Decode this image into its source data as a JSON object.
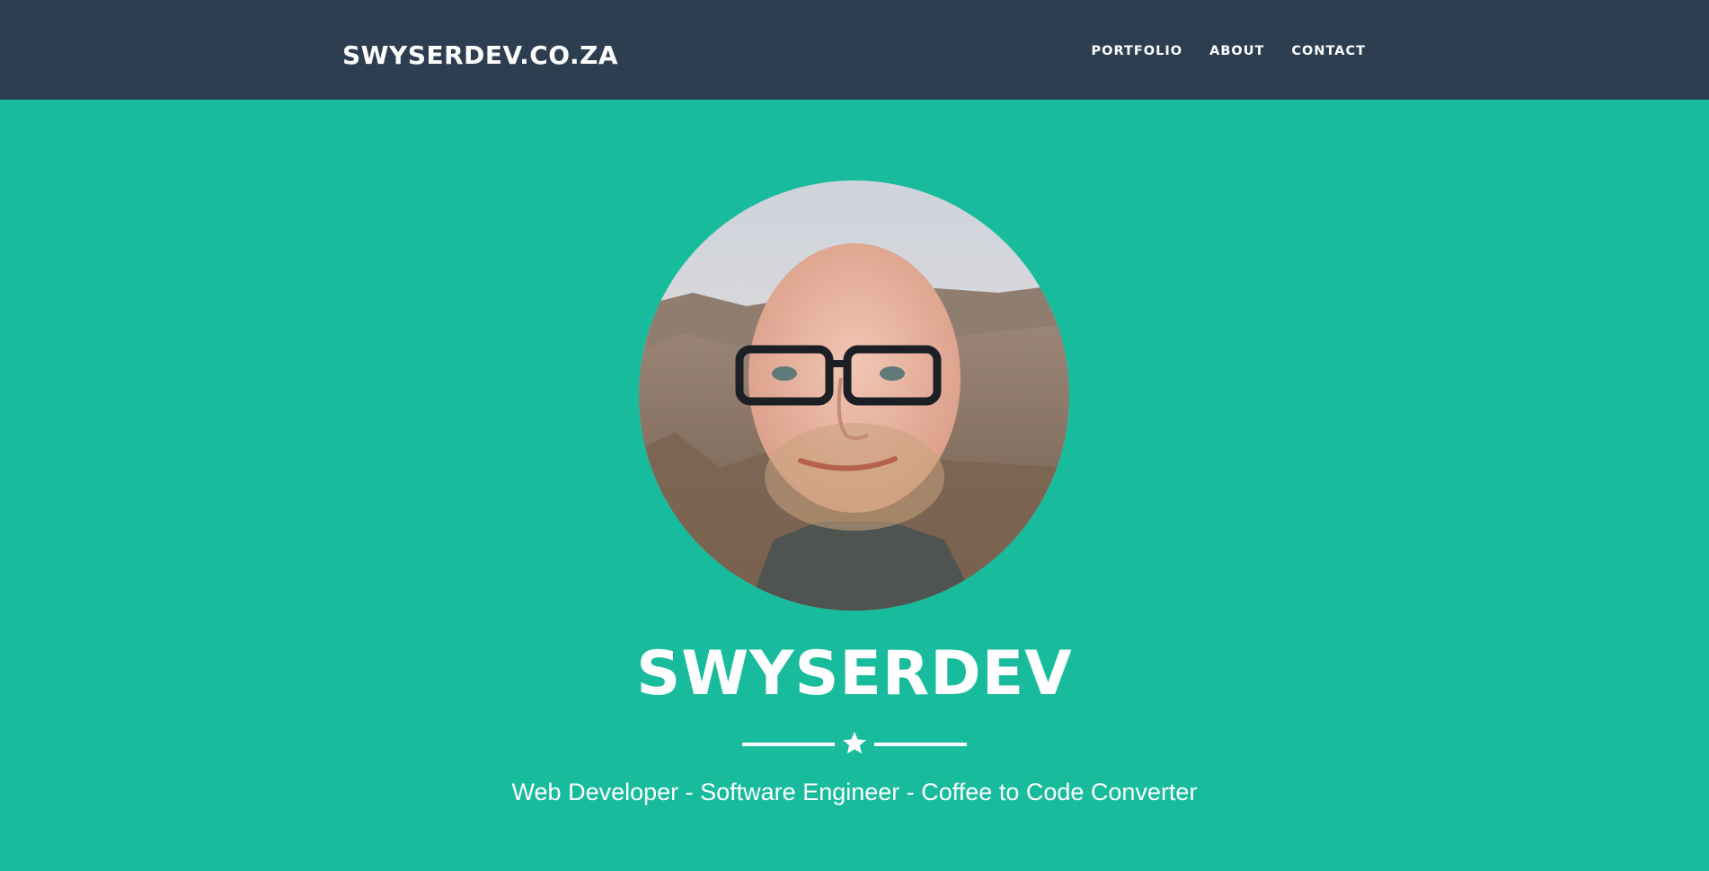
{
  "navbar": {
    "brand": "SWYSERDEV.CO.ZA",
    "links": [
      {
        "label": "PORTFOLIO"
      },
      {
        "label": "ABOUT"
      },
      {
        "label": "CONTACT"
      }
    ]
  },
  "hero": {
    "avatar_description": "profile-photo",
    "title": "SWYSERDEV",
    "divider_icon": "star-icon",
    "subtitle": "Web Developer - Software Engineer - Coffee to Code Converter"
  },
  "colors": {
    "navbar_bg": "#2c3e50",
    "hero_bg": "#18bc9c",
    "text": "#ffffff"
  }
}
